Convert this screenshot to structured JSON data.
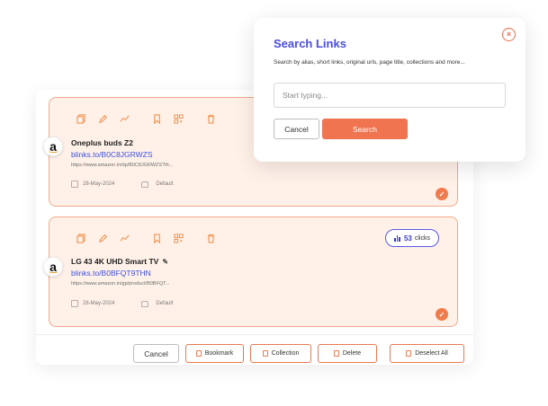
{
  "links": [
    {
      "title": "Oneplus buds Z2",
      "short_url": "blinks.to/B0C8JGRWZS",
      "original_url": "https://www.amazon.in/dp/B0C8JGRWZS?th...",
      "date": "28-May-2024",
      "collection": "Default",
      "logo_letter": "a"
    },
    {
      "title": "LG 43 4K UHD Smart TV",
      "short_url": "blinks.to/B0BFQT9THN",
      "original_url": "https://www.amazon.in/gp/product/B0BFQT...",
      "date": "28-May-2024",
      "collection": "Default",
      "logo_letter": "a",
      "clicks_count": "53",
      "clicks_label": "clicks"
    }
  ],
  "toolbar_icons": [
    "copy-icon",
    "edit-icon",
    "analytics-icon",
    "bookmark-icon",
    "qr-icon",
    "delete-icon"
  ],
  "action_bar": {
    "cancel": "Cancel",
    "bookmark": "Bookmark",
    "collection": "Collection",
    "delete": "Delete",
    "deselect_all": "Deselect All"
  },
  "search_modal": {
    "title": "Search Links",
    "description": "Search by alias, short links, original urls, page title, collections and more...",
    "placeholder": "Start typing...",
    "cancel": "Cancel",
    "search": "Search",
    "close_glyph": "×"
  },
  "colors": {
    "accent": "#f07450",
    "link_blue": "#3b4fe0",
    "title_purple": "#4a4de0",
    "card_bg": "#fff1e8"
  }
}
